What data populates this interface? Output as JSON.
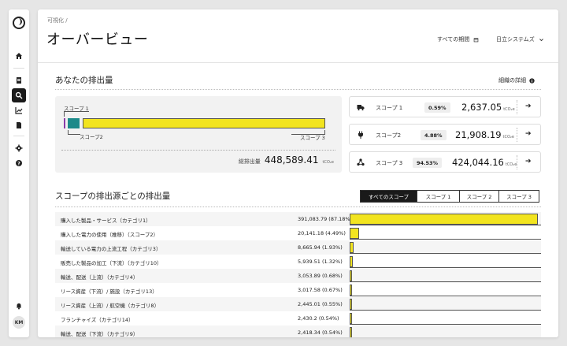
{
  "sidebar": {
    "avatar": "KM"
  },
  "header": {
    "breadcrumb": "可視化 /",
    "title": "オーバービュー",
    "period_label": "すべての期間",
    "company_label": "日立システムズ"
  },
  "summary": {
    "title": "あなたの排出量",
    "detail_link": "細織の詳細",
    "scope1_label": "スコープ 1",
    "scope2_label": "スコープ2",
    "scope3_label": "スコープ 3",
    "total_label": "総排出量",
    "total_value": "448,589.41",
    "unit": "tCO₂e"
  },
  "scopes": [
    {
      "name": "スコープ 1",
      "pct": "0.59%",
      "value": "2,637.05",
      "unit": "tCO₂e",
      "icon": "truck-icon"
    },
    {
      "name": "スコープ2",
      "pct": "4.88%",
      "value": "21,908.19",
      "unit": "tCO₂e",
      "icon": "plug-icon"
    },
    {
      "name": "スコープ 3",
      "pct": "94.53%",
      "value": "424,044.16",
      "unit": "tCO₂e",
      "icon": "network-icon"
    }
  ],
  "sources": {
    "title": "スコープの排出源ごとの排出量",
    "tabs": [
      "すべてのスコープ",
      "スコープ 1",
      "スコープ 2",
      "スコープ 3"
    ],
    "active_tab": 0,
    "rows": [
      {
        "label": "購入した製品・サービス（カテゴリ1）",
        "value": "391,083.79 (87.18%)",
        "pct": 87.18
      },
      {
        "label": "購入した電力の使用（推移）（スコープ2）",
        "value": "20,141.18 (4.49%)",
        "pct": 4.49
      },
      {
        "label": "輸送している電力の上流工程（カテゴリ3）",
        "value": "8,665.94 (1.93%)",
        "pct": 1.93
      },
      {
        "label": "販売した製品の加工（下流）（カテゴリ10）",
        "value": "5,939.51 (1.32%)",
        "pct": 1.32
      },
      {
        "label": "輸送、配送（上流）（カテゴリ4）",
        "value": "3,053.89 (0.68%)",
        "pct": 0.68
      },
      {
        "label": "リース資産（下流）/ 施設（カテゴリ13）",
        "value": "3,017.58 (0.67%)",
        "pct": 0.67
      },
      {
        "label": "リース資産（上流）/ 航空機（カテゴリ8）",
        "value": "2,445.01 (0.55%)",
        "pct": 0.55
      },
      {
        "label": "フランチャイズ（カテゴリ14）",
        "value": "2,430.2 (0.54%)",
        "pct": 0.54
      },
      {
        "label": "輸送、配送（下流）（カテゴリ9）",
        "value": "2,418.34 (0.54%)",
        "pct": 0.54
      }
    ]
  },
  "colors": {
    "scope1": "#8a3ca8",
    "scope2": "#1d8a8a",
    "scope3": "#f2e41f"
  }
}
